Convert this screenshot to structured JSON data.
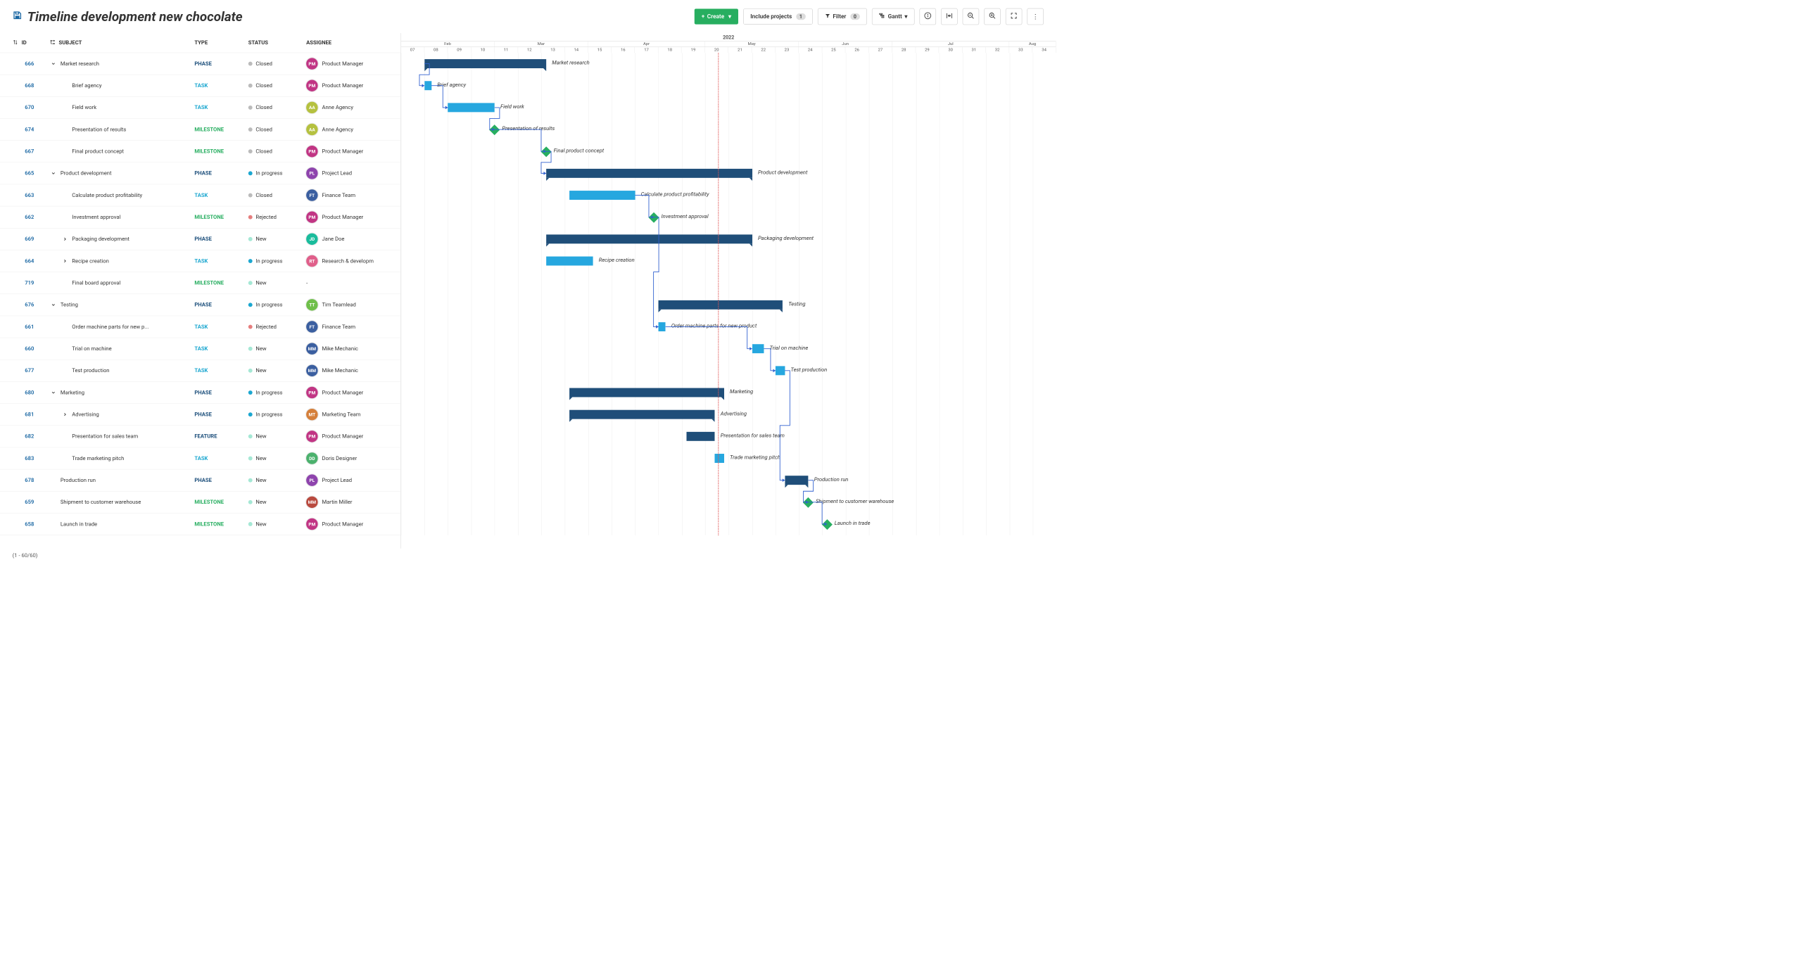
{
  "page": {
    "title": "Timeline development new chocolate",
    "footer": "(1 - 60/60)"
  },
  "toolbar": {
    "create": "Create",
    "include_projects": "Include projects",
    "include_count": "1",
    "filter": "Filter",
    "filter_count": "0",
    "gantt": "Gantt"
  },
  "columns": {
    "id": "ID",
    "subject": "SUBJECT",
    "type": "TYPE",
    "status": "STATUS",
    "assignee": "ASSIGNEE"
  },
  "statuses": {
    "closed": "Closed",
    "in_progress": "In progress",
    "rejected": "Rejected",
    "new": "New"
  },
  "types": {
    "phase": "PHASE",
    "task": "TASK",
    "milestone": "MILESTONE",
    "feature": "FEATURE"
  },
  "timeline": {
    "year": "2022",
    "months": [
      "Feb",
      "Mar",
      "Apr",
      "May",
      "Jun",
      "Jul",
      "Aug"
    ],
    "month_weeks": [
      "07",
      "08",
      "09",
      "10",
      "11",
      "12",
      "13",
      "14",
      "15",
      "16",
      "17",
      "18",
      "19",
      "20",
      "21",
      "22",
      "23",
      "24",
      "25",
      "26",
      "27",
      "28",
      "29",
      "30",
      "31",
      "32",
      "33",
      "34"
    ],
    "today_week_fraction": 13.54
  },
  "chart_data": {
    "type": "gantt",
    "x_unit": "week_of_year",
    "x_range": [
      7,
      34
    ],
    "rows": [
      {
        "id": "666",
        "subject": "Market research",
        "type": "phase",
        "status": "closed",
        "assignee": {
          "name": "Product Manager",
          "initials": "PM",
          "color": "#c13584"
        },
        "indent": 1,
        "expand": "down",
        "start": 8,
        "end": 13.2,
        "label": "Market research"
      },
      {
        "id": "668",
        "subject": "Brief agency",
        "type": "task",
        "status": "closed",
        "assignee": {
          "name": "Product Manager",
          "initials": "PM",
          "color": "#c13584"
        },
        "indent": 2,
        "start": 8,
        "end": 8.3,
        "label": "Brief agency"
      },
      {
        "id": "670",
        "subject": "Field work",
        "type": "task",
        "status": "closed",
        "assignee": {
          "name": "Anne Agency",
          "initials": "AA",
          "color": "#b5c13f"
        },
        "indent": 2,
        "start": 9,
        "end": 11,
        "label": "Field work"
      },
      {
        "id": "674",
        "subject": "Presentation of results",
        "type": "milestone",
        "status": "closed",
        "assignee": {
          "name": "Anne Agency",
          "initials": "AA",
          "color": "#b5c13f"
        },
        "indent": 2,
        "at": 11,
        "label": "Presentation of results"
      },
      {
        "id": "667",
        "subject": "Final product concept",
        "type": "milestone",
        "status": "closed",
        "assignee": {
          "name": "Product Manager",
          "initials": "PM",
          "color": "#c13584"
        },
        "indent": 2,
        "at": 13.2,
        "label": "Final product concept"
      },
      {
        "id": "665",
        "subject": "Product development",
        "type": "phase",
        "status": "in_progress",
        "assignee": {
          "name": "Project Lead",
          "initials": "PL",
          "color": "#8e44ad"
        },
        "indent": 1,
        "expand": "down",
        "start": 13.2,
        "end": 22,
        "label": "Product development"
      },
      {
        "id": "663",
        "subject": "Calculate product profitability",
        "type": "task",
        "status": "closed",
        "assignee": {
          "name": "Finance Team",
          "initials": "FT",
          "color": "#3b5fa0"
        },
        "indent": 2,
        "start": 14.2,
        "end": 17,
        "label": "Calculate product profitability"
      },
      {
        "id": "662",
        "subject": "Investment approval",
        "type": "milestone",
        "status": "rejected",
        "assignee": {
          "name": "Product Manager",
          "initials": "PM",
          "color": "#c13584"
        },
        "indent": 2,
        "at": 17.8,
        "label": "Investment approval"
      },
      {
        "id": "669",
        "subject": "Packaging development",
        "type": "phase",
        "status": "new",
        "assignee": {
          "name": "Jane Doe",
          "initials": "JD",
          "color": "#1abc9c"
        },
        "indent": 2,
        "expand": "right",
        "start": 13.2,
        "end": 22,
        "label": "Packaging development"
      },
      {
        "id": "664",
        "subject": "Recipe creation",
        "type": "task",
        "status": "in_progress",
        "assignee": {
          "name": "Research & developm",
          "initials": "RT",
          "color": "#e05f8a"
        },
        "indent": 2,
        "expand": "right",
        "start": 13.2,
        "end": 15.2,
        "label": "Recipe creation"
      },
      {
        "id": "719",
        "subject": "Final board approval",
        "type": "milestone",
        "status": "new",
        "assignee": {
          "name": "-",
          "initials": "",
          "color": ""
        },
        "indent": 2
      },
      {
        "id": "676",
        "subject": "Testing",
        "type": "phase",
        "status": "in_progress",
        "assignee": {
          "name": "Tim Teamlead",
          "initials": "TT",
          "color": "#6fbf4a"
        },
        "indent": 1,
        "expand": "down",
        "start": 18,
        "end": 23.3,
        "label": "Testing"
      },
      {
        "id": "661",
        "subject": "Order machine parts for new p...",
        "type": "task",
        "status": "rejected",
        "assignee": {
          "name": "Finance Team",
          "initials": "FT",
          "color": "#3b5fa0"
        },
        "indent": 2,
        "start": 18,
        "end": 18.3,
        "label": "Order machine parts for new product"
      },
      {
        "id": "660",
        "subject": "Trial on machine",
        "type": "task",
        "status": "new",
        "assignee": {
          "name": "Mike Mechanic",
          "initials": "MM",
          "color": "#3b5fa0"
        },
        "indent": 2,
        "start": 22,
        "end": 22.5,
        "label": "Trial on machine"
      },
      {
        "id": "677",
        "subject": "Test production",
        "type": "task",
        "status": "new",
        "assignee": {
          "name": "Mike Mechanic",
          "initials": "MM",
          "color": "#3b5fa0"
        },
        "indent": 2,
        "start": 23,
        "end": 23.4,
        "label": "Test production"
      },
      {
        "id": "680",
        "subject": "Marketing",
        "type": "phase",
        "status": "in_progress",
        "assignee": {
          "name": "Product Manager",
          "initials": "PM",
          "color": "#c13584"
        },
        "indent": 1,
        "expand": "down",
        "start": 14.2,
        "end": 20.8,
        "label": "Marketing"
      },
      {
        "id": "681",
        "subject": "Advertising",
        "type": "phase",
        "status": "in_progress",
        "assignee": {
          "name": "Marketing Team",
          "initials": "MT",
          "color": "#d57f3a"
        },
        "indent": 2,
        "expand": "right",
        "start": 14.2,
        "end": 20.4,
        "label": "Advertising"
      },
      {
        "id": "682",
        "subject": "Presentation for sales team",
        "type": "feature",
        "status": "new",
        "assignee": {
          "name": "Product Manager",
          "initials": "PM",
          "color": "#c13584"
        },
        "indent": 2,
        "start": 19.2,
        "end": 20.4,
        "label": "Presentation for sales team"
      },
      {
        "id": "683",
        "subject": "Trade marketing pitch",
        "type": "task",
        "status": "new",
        "assignee": {
          "name": "Doris Designer",
          "initials": "DD",
          "color": "#4bb16d"
        },
        "indent": 2,
        "start": 20.4,
        "end": 20.8,
        "label": "Trade marketing pitch"
      },
      {
        "id": "678",
        "subject": "Production run",
        "type": "phase",
        "status": "new",
        "assignee": {
          "name": "Project Lead",
          "initials": "PL",
          "color": "#8e44ad"
        },
        "indent": 1,
        "start": 23.4,
        "end": 24.4,
        "label": "Production run"
      },
      {
        "id": "659",
        "subject": "Shipment to customer warehouse",
        "type": "milestone",
        "status": "new",
        "assignee": {
          "name": "Martin Miller",
          "initials": "MM",
          "color": "#b94a3f"
        },
        "indent": 1,
        "at": 24.4,
        "label": "Shipment to customer warehouse"
      },
      {
        "id": "658",
        "subject": "Launch in trade",
        "type": "milestone",
        "status": "new",
        "assignee": {
          "name": "Product Manager",
          "initials": "PM",
          "color": "#c13584"
        },
        "indent": 1,
        "at": 25.2,
        "label": "Launch in trade"
      }
    ],
    "dependencies": [
      {
        "from": 0,
        "to": 1,
        "from_side": "start",
        "to_side": "start"
      },
      {
        "from": 1,
        "to": 2,
        "from_side": "end",
        "to_side": "start"
      },
      {
        "from": 2,
        "to": 3,
        "from_side": "end",
        "to_side": "at"
      },
      {
        "from": 3,
        "to": 4,
        "from_side": "at",
        "to_side": "at"
      },
      {
        "from": 4,
        "to": 5,
        "from_side": "at",
        "to_side": "start"
      },
      {
        "from": 6,
        "to": 7,
        "from_side": "end",
        "to_side": "at"
      },
      {
        "from": 7,
        "to": 12,
        "from_side": "at",
        "to_side": "start"
      },
      {
        "from": 12,
        "to": 13,
        "from_side": "end",
        "to_side": "start"
      },
      {
        "from": 13,
        "to": 14,
        "from_side": "end",
        "to_side": "start"
      },
      {
        "from": 14,
        "to": 19,
        "from_side": "end",
        "to_side": "start"
      },
      {
        "from": 19,
        "to": 20,
        "from_side": "end",
        "to_side": "at"
      },
      {
        "from": 20,
        "to": 21,
        "from_side": "at",
        "to_side": "at"
      }
    ]
  }
}
